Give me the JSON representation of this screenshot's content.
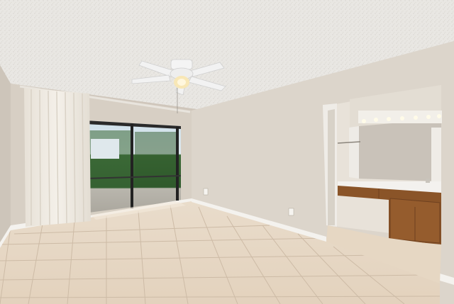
{
  "scene": {
    "kind": "real-estate-interior-photo",
    "room": "empty bedroom",
    "colors": {
      "ceiling": "#e9e7e3",
      "wall_back": "#d9d1c7",
      "wall_right": "#ddd6cc",
      "wall_left": "#cfc7bc",
      "floor_tile": "#e7d8c5",
      "grout": "#cdbba6",
      "baseboard": "#f4f2ee",
      "curtain": "#f0ece4",
      "cabinet_wood": "#8a5428",
      "countertop": "#f3f1ee",
      "mirror": "#c9c2b9",
      "vanity_light": "#fffbe8",
      "fan": "#f2f2f2",
      "glass_frame": "#222222",
      "outdoor_trees": "#2f5a2c",
      "outdoor_sky": "#cfe0ea"
    },
    "icons": [
      "ceiling-fan-icon",
      "light-fixture-icon",
      "electrical-outlet-icon"
    ]
  }
}
